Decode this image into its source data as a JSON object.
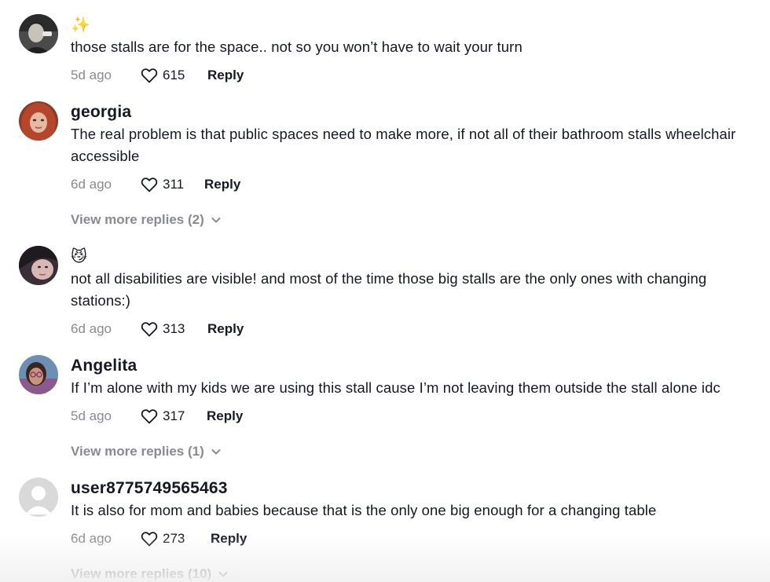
{
  "comments": [
    {
      "username": "",
      "name_emoji": "✨",
      "text": "those stalls are for the space.. not so you won’t have to wait your turn",
      "date": "5d ago",
      "likes": "615",
      "reply_label": "Reply",
      "avatar": "avatar-photo-man"
    },
    {
      "username": "georgia",
      "text": "The real problem is that public spaces need to make more, if not all of their bathroom stalls wheelchair accessible",
      "date": "6d ago",
      "likes": "311",
      "reply_label": "Reply",
      "view_more": "View more replies (2)",
      "avatar": "avatar-photo-woman-red"
    },
    {
      "username": "",
      "name_emoji": "😼",
      "text": "not all disabilities are visible! and most of the time those big stalls are the only ones with changing stations:)",
      "date": "6d ago",
      "likes": "313",
      "reply_label": "Reply",
      "avatar": "avatar-photo-woman-dark"
    },
    {
      "username": "Angelita",
      "text": "If I’m alone with my kids we are using this stall cause I’m not leaving them outside the stall alone idc",
      "date": "5d ago",
      "likes": "317",
      "reply_label": "Reply",
      "view_more": "View more replies (1)",
      "avatar": "avatar-photo-woman-glasses"
    },
    {
      "username": "user8775749565463",
      "text": "It is also for mom and babies because that is the only one big enough for a changing table",
      "date": "6d ago",
      "likes": "273",
      "reply_label": "Reply",
      "view_more": "View more replies (10)",
      "avatar": "avatar-default-placeholder"
    }
  ],
  "icons": {
    "like": "heart-outline-icon",
    "expand": "chevron-down-icon"
  },
  "colors": {
    "text": "#161823",
    "muted": "#8a8b91",
    "placeholder_avatar": "#d8d8d8"
  }
}
